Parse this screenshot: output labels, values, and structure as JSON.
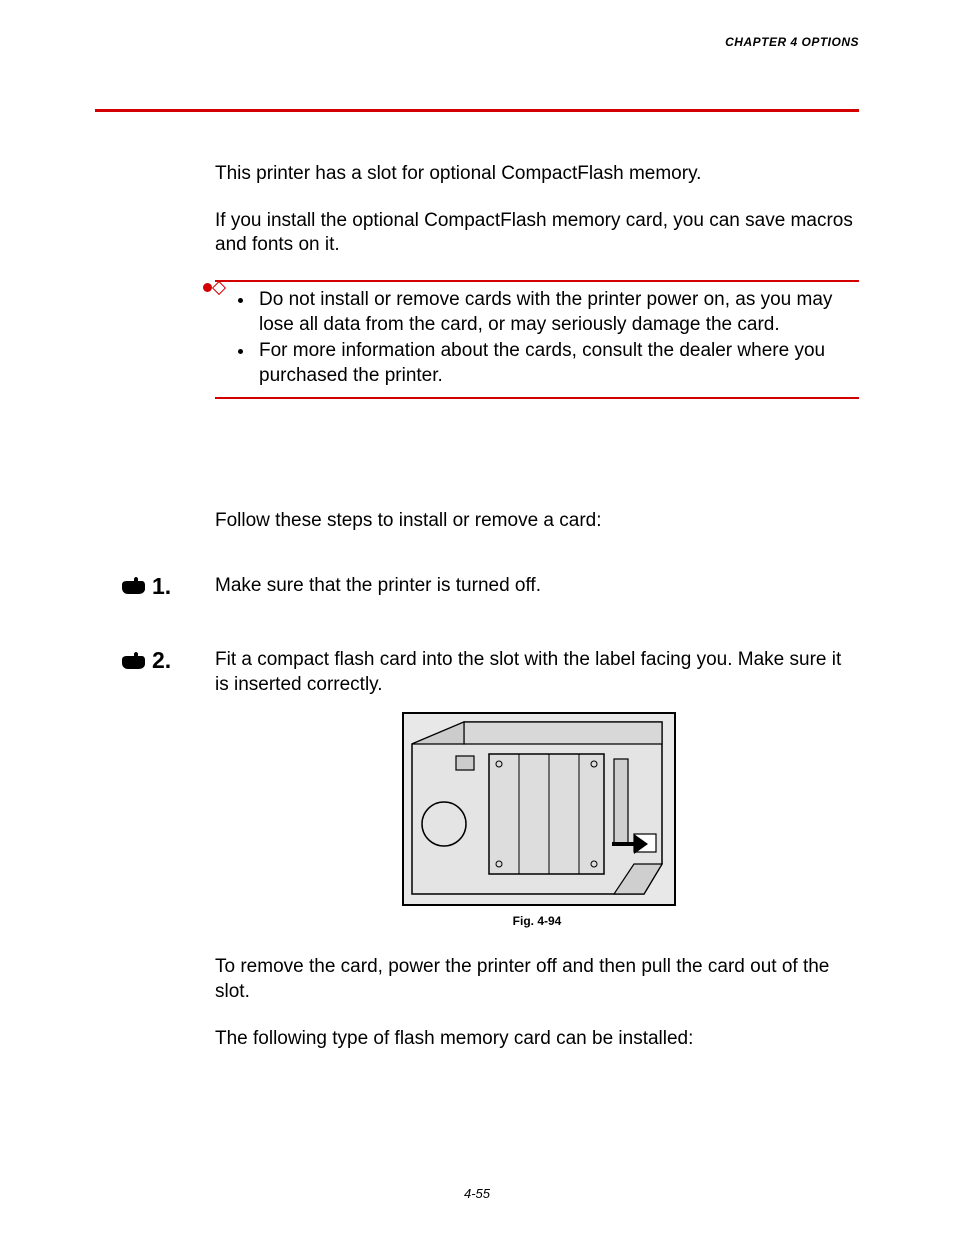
{
  "header": {
    "chapter_label": "CHAPTER 4 OPTIONS"
  },
  "intro": {
    "p1": "This printer has a slot for optional CompactFlash memory.",
    "p2": "If you install the optional CompactFlash memory card, you can save macros and fonts on it."
  },
  "warning": {
    "bullets": [
      "Do not install or remove cards with the printer power on, as you may lose all data from the card, or may seriously damage the card.",
      "For more information about the cards, consult the dealer where you purchased the printer."
    ]
  },
  "steps_intro": "Follow these steps to install or remove a card:",
  "steps": [
    {
      "num": "1.",
      "text": "Make sure that the printer is turned off."
    },
    {
      "num": "2.",
      "text": "Fit a compact flash card into the slot with the label facing you. Make sure it is inserted correctly."
    }
  ],
  "figure": {
    "caption": "Fig. 4-94"
  },
  "after": {
    "p1": "To remove the card, power the printer off and then pull the card out of the slot.",
    "p2": "The following type of flash memory card can be installed:"
  },
  "page_number": "4-55"
}
